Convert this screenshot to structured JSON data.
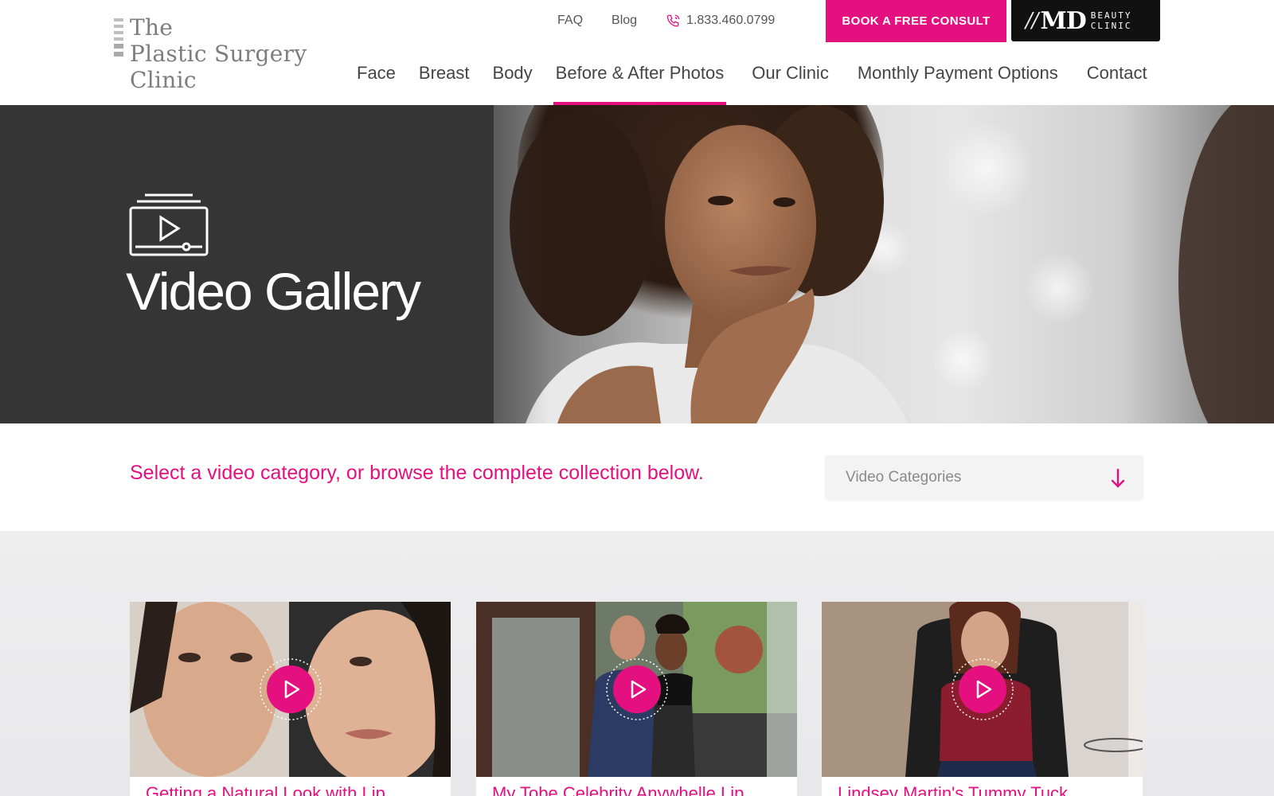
{
  "header": {
    "logo_lines": [
      "The",
      "Plastic Surgery",
      "Clinic"
    ],
    "top_links": [
      "FAQ",
      "Blog"
    ],
    "phone": "1.833.460.0799",
    "cta_label": "BOOK A FREE CONSULT",
    "md_badge": {
      "slash": "//",
      "main": "MD",
      "sub_line1": "BEAUTY",
      "sub_line2": "CLINIC"
    },
    "nav": [
      {
        "label": "Face"
      },
      {
        "label": "Breast"
      },
      {
        "label": "Body"
      },
      {
        "label": "Before & After Photos",
        "active": true
      },
      {
        "label": "Our Clinic"
      },
      {
        "label": "Monthly Payment Options"
      },
      {
        "label": "Contact"
      }
    ]
  },
  "hero": {
    "title": "Video Gallery",
    "icon": "video-gallery-icon"
  },
  "category": {
    "prompt": "Select a video category, or browse the complete collection below.",
    "select_placeholder": "Video Categories"
  },
  "videos": [
    {
      "title": "Getting a Natural Look with Lip..."
    },
    {
      "title": "My Tobe Celebrity Anywhelle Lip..."
    },
    {
      "title": "Lindsey Martin's Tummy Tuck..."
    }
  ],
  "colors": {
    "accent": "#e5107f",
    "dark": "#353535",
    "badge": "#111111"
  }
}
